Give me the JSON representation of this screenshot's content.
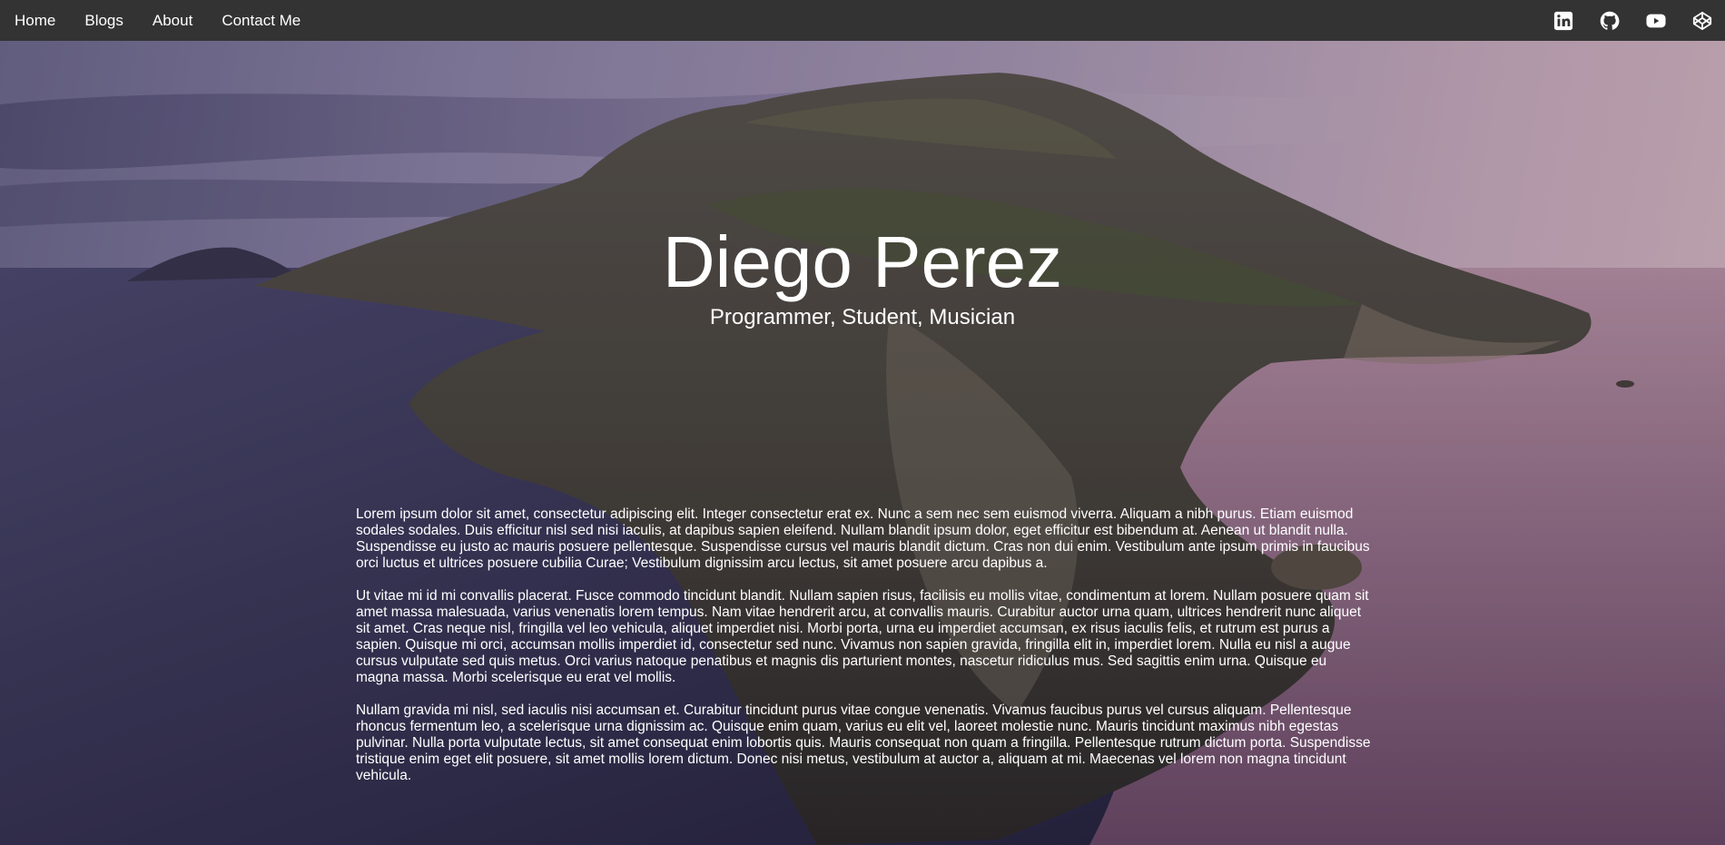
{
  "nav": {
    "links": [
      "Home",
      "Blogs",
      "About",
      "Contact Me"
    ]
  },
  "social": [
    {
      "icon": "linkedin-icon"
    },
    {
      "icon": "github-icon"
    },
    {
      "icon": "youtube-icon"
    },
    {
      "icon": "codepen-icon"
    }
  ],
  "hero": {
    "title": "Diego Perez",
    "subtitle": "Programmer, Student, Musician"
  },
  "content": {
    "paragraphs": [
      "Lorem ipsum dolor sit amet, consectetur adipiscing elit. Integer consectetur erat ex. Nunc a sem nec sem euismod viverra. Aliquam a nibh purus. Etiam euismod sodales sodales. Duis efficitur nisl sed nisi iaculis, at dapibus sapien eleifend. Nullam blandit ipsum dolor, eget efficitur est bibendum at. Aenean ut blandit nulla. Suspendisse eu justo ac mauris posuere pellentesque. Suspendisse cursus vel mauris blandit dictum. Cras non dui enim. Vestibulum ante ipsum primis in faucibus orci luctus et ultrices posuere cubilia Curae; Vestibulum dignissim arcu lectus, sit amet posuere arcu dapibus a.",
      "Ut vitae mi id mi convallis placerat. Fusce commodo tincidunt blandit. Nullam sapien risus, facilisis eu mollis vitae, condimentum at lorem. Nullam posuere quam sit amet massa malesuada, varius venenatis lorem tempus. Nam vitae hendrerit arcu, at convallis mauris. Curabitur auctor urna quam, ultrices hendrerit nunc aliquet sit amet. Cras neque nisl, fringilla vel leo vehicula, aliquet imperdiet nisi. Morbi porta, urna eu imperdiet accumsan, ex risus iaculis felis, et rutrum est purus a sapien. Quisque mi orci, accumsan mollis imperdiet id, consectetur sed nunc. Vivamus non sapien gravida, fringilla elit in, imperdiet lorem. Nulla eu nisl a augue cursus vulputate sed quis metus. Orci varius natoque penatibus et magnis dis parturient montes, nascetur ridiculus mus. Sed sagittis enim urna. Quisque eu magna massa. Morbi scelerisque eu erat vel mollis.",
      "Nullam gravida mi nisl, sed iaculis nisi accumsan et. Curabitur tincidunt purus vitae congue venenatis. Vivamus faucibus purus vel cursus aliquam. Pellentesque rhoncus fermentum leo, a scelerisque urna dignissim ac. Quisque enim quam, varius eu elit vel, laoreet molestie nunc. Mauris tincidunt maximus nibh egestas pulvinar. Nulla porta vulputate lectus, sit amet consequat enim lobortis quis. Mauris consequat non quam a fringilla. Pellentesque rutrum dictum porta. Suspendisse tristique enim eget elit posuere, sit amet mollis lorem dictum. Donec nisi metus, vestibulum at auctor a, aliquam at mi. Maecenas vel lorem non magna tincidunt vehicula."
    ]
  },
  "colors": {
    "navbar": "#333333",
    "text": "#ffffff"
  }
}
